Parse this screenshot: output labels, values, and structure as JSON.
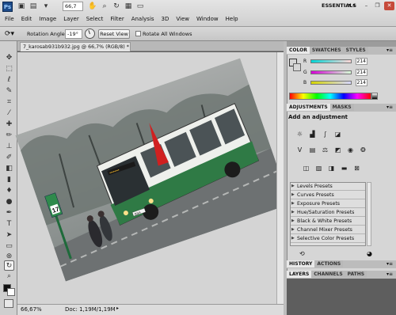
{
  "app": {
    "logo": "Ps",
    "zoom": "66,7",
    "workspace": "ESSENTIALS"
  },
  "menu": [
    "File",
    "Edit",
    "Image",
    "Layer",
    "Select",
    "Filter",
    "Analysis",
    "3D",
    "View",
    "Window",
    "Help"
  ],
  "options": {
    "rotation_label": "Rotation Angle:",
    "rotation_value": "-19°",
    "reset_label": "Reset View",
    "rotate_all_label": "Rotate All Windows"
  },
  "document": {
    "tab_title": "7_karosab931b932.jpg @ 66,7% (RGB/8) *",
    "status_zoom": "66,67%",
    "status_doc": "Doc: 1,19M/1,19M"
  },
  "color_panel": {
    "tabs": [
      "COLOR",
      "SWATCHES",
      "STYLES"
    ],
    "channels": [
      {
        "label": "R",
        "value": "214"
      },
      {
        "label": "G",
        "value": "214"
      },
      {
        "label": "B",
        "value": "214"
      }
    ]
  },
  "adjustments_panel": {
    "tabs": [
      "ADJUSTMENTS",
      "MASKS"
    ],
    "heading": "Add an adjustment",
    "presets": [
      "Levels Presets",
      "Curves Presets",
      "Exposure Presets",
      "Hue/Saturation Presets",
      "Black & White Presets",
      "Channel Mixer Presets",
      "Selective Color Presets"
    ]
  },
  "history_panel": {
    "tabs": [
      "HISTORY",
      "ACTIONS"
    ]
  },
  "layers_panel": {
    "tabs": [
      "LAYERS",
      "CHANNELS",
      "PATHS"
    ]
  },
  "photo": {
    "route_sign": "17",
    "bus_plate": "BSA"
  },
  "icons": {
    "tools": [
      "move-icon",
      "marquee-icon",
      "lasso-icon",
      "quick-select-icon",
      "crop-icon",
      "eyedropper-icon",
      "healing-icon",
      "brush-icon",
      "clone-stamp-icon",
      "history-brush-icon",
      "eraser-icon",
      "gradient-icon",
      "blur-icon",
      "dodge-icon",
      "pen-icon",
      "type-icon",
      "path-select-icon",
      "shape-icon",
      "3d-rotate-icon",
      "3d-orbit-icon",
      "hand-icon",
      "rotate-view-icon",
      "zoom-icon"
    ]
  }
}
